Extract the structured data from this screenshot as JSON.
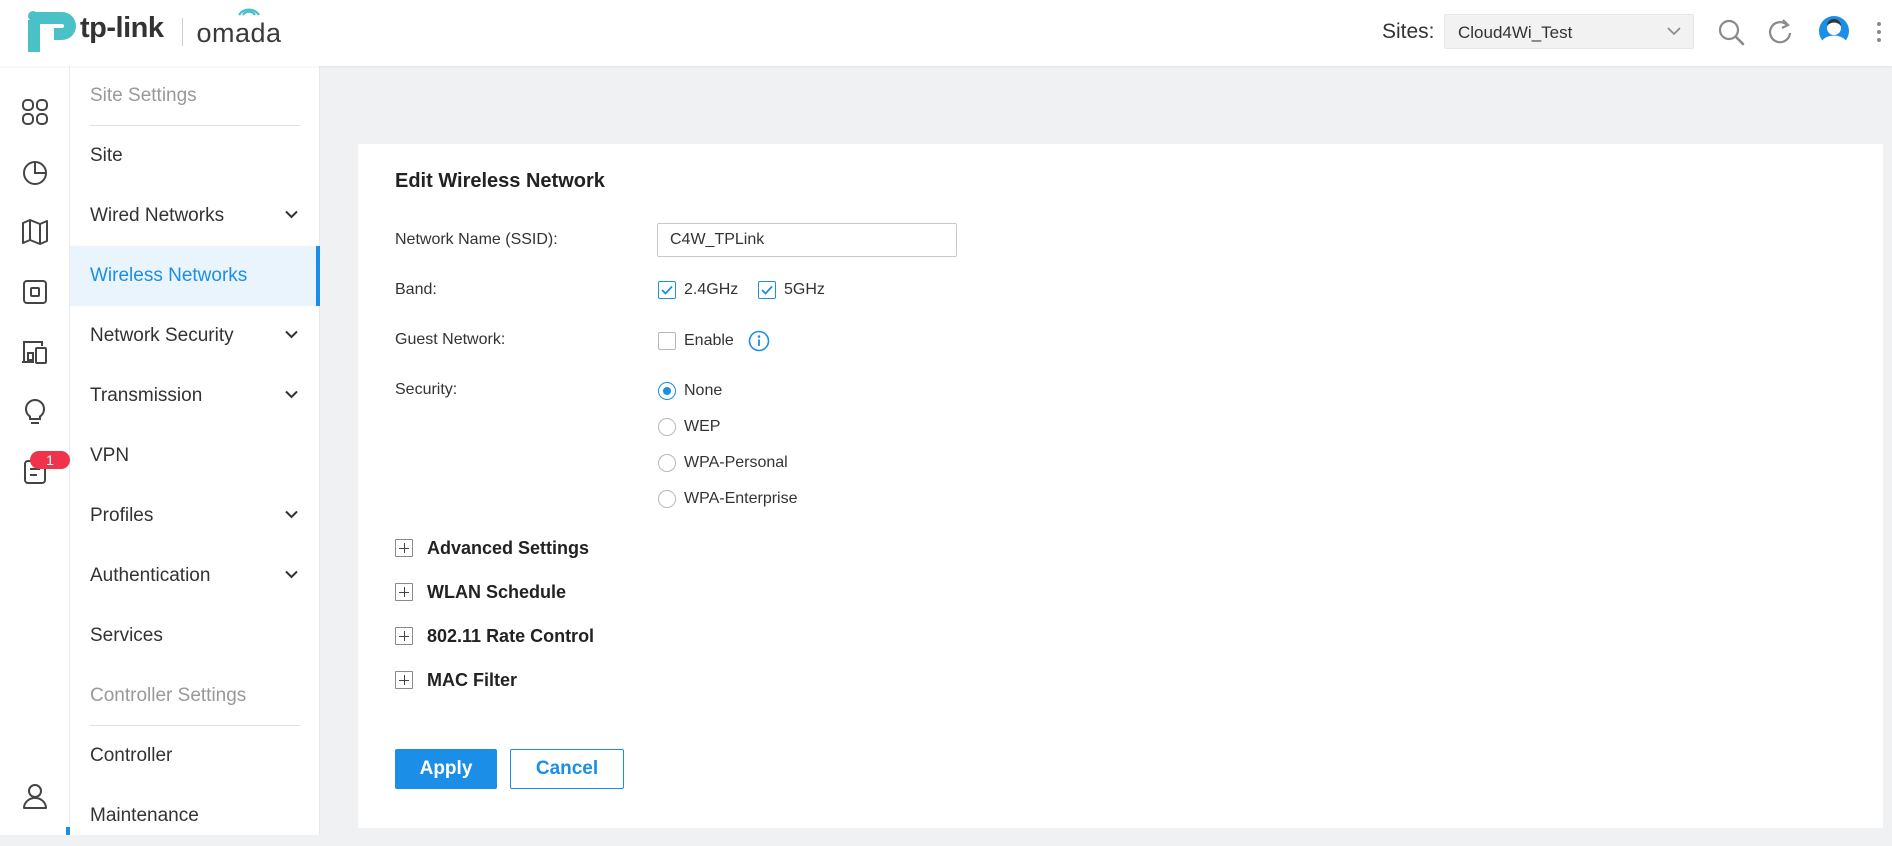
{
  "header": {
    "logo_brand": "tp-link",
    "logo_product": "omada",
    "sites_label": "Sites:",
    "sites_selected": "Cloud4Wi_Test",
    "icons": [
      "search-icon",
      "refresh-icon",
      "user-avatar-icon",
      "more-vertical-icon"
    ]
  },
  "iconbar": {
    "items": [
      "dashboard-icon",
      "statistics-icon",
      "map-icon",
      "devices-icon",
      "clients-icon",
      "insight-icon",
      "logs-icon"
    ],
    "notification_count": "1",
    "bottom_icon": "account-icon"
  },
  "sidemenu": {
    "items": [
      {
        "label": "Site Settings",
        "type": "section"
      },
      {
        "label": "Site",
        "type": "item"
      },
      {
        "label": "Wired Networks",
        "type": "expandable"
      },
      {
        "label": "Wireless Networks",
        "type": "active"
      },
      {
        "label": "Network Security",
        "type": "expandable"
      },
      {
        "label": "Transmission",
        "type": "expandable"
      },
      {
        "label": "VPN",
        "type": "item"
      },
      {
        "label": "Profiles",
        "type": "expandable"
      },
      {
        "label": "Authentication",
        "type": "expandable"
      },
      {
        "label": "Services",
        "type": "item"
      },
      {
        "label": "Controller Settings",
        "type": "section"
      },
      {
        "label": "Controller",
        "type": "item"
      },
      {
        "label": "Maintenance",
        "type": "item"
      }
    ]
  },
  "form": {
    "title": "Edit Wireless Network",
    "ssid_label": "Network Name (SSID):",
    "ssid_value": "C4W_TPLink",
    "band_label": "Band:",
    "bands": [
      {
        "label": "2.4GHz",
        "checked": true
      },
      {
        "label": "5GHz",
        "checked": true
      }
    ],
    "guest_label": "Guest Network:",
    "guest_option": "Enable",
    "guest_checked": false,
    "security_label": "Security:",
    "security_options": [
      "None",
      "WEP",
      "WPA-Personal",
      "WPA-Enterprise"
    ],
    "security_selected": "None",
    "sections": [
      "Advanced Settings",
      "WLAN Schedule",
      "802.11 Rate Control",
      "MAC Filter"
    ],
    "apply_label": "Apply",
    "cancel_label": "Cancel"
  },
  "colors": {
    "accent": "#1b8ee7",
    "logo_teal": "#4ac1c7",
    "badge": "#f0324a",
    "page_bg": "#f0f1f2"
  }
}
